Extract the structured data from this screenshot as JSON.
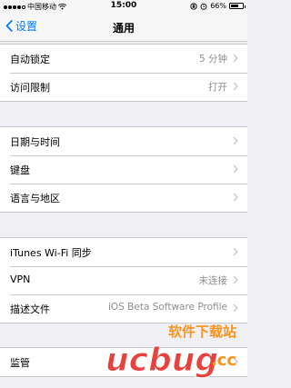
{
  "status_bar": {
    "carrier": "中国移动",
    "time": "15:00",
    "battery_percent": "66%",
    "battery_level": 0.66,
    "signal_bars": 4,
    "icons": [
      "signal-icon",
      "wifi-icon",
      "lock-rotation-icon",
      "alarm-icon",
      "battery-icon"
    ]
  },
  "nav": {
    "back_label": "设置",
    "title": "通用"
  },
  "groups": [
    {
      "rows": [
        {
          "label": "自动锁定",
          "value": "5 分钟"
        },
        {
          "label": "访问限制",
          "value": "打开"
        }
      ]
    },
    {
      "rows": [
        {
          "label": "日期与时间",
          "value": ""
        },
        {
          "label": "键盘",
          "value": ""
        },
        {
          "label": "语言与地区",
          "value": ""
        }
      ]
    },
    {
      "rows": [
        {
          "label": "iTunes Wi-Fi 同步",
          "value": ""
        },
        {
          "label": "VPN",
          "value": "未连接"
        },
        {
          "label": "描述文件",
          "value": "iOS Beta Software Profile"
        }
      ]
    },
    {
      "rows": [
        {
          "label": "监管",
          "value": ""
        }
      ]
    }
  ],
  "watermark": {
    "text_cn": "软件下载站",
    "text_logo": "ucbug",
    "text_domain": ".cc"
  },
  "colors": {
    "accent": "#007aff",
    "secondary_text": "#8e8e93",
    "background": "#efeff4",
    "watermark_orange": "#f7941d",
    "watermark_red": "#e8423f"
  }
}
